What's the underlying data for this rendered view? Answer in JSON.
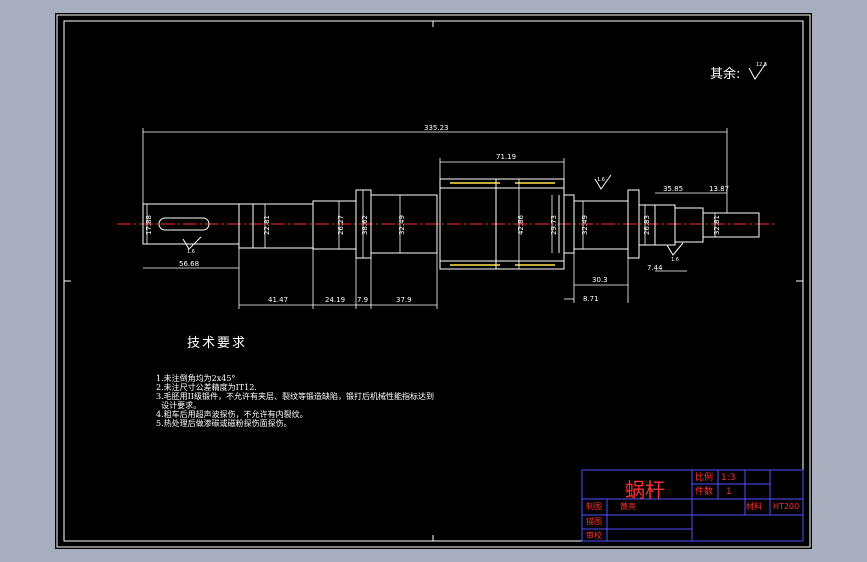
{
  "drawing": {
    "roughness_note": "其余:",
    "roughness_value": "12.5",
    "dimensions": {
      "overall_length": "335.23",
      "worm_length": "71.19",
      "keyway_width": "17.88",
      "d1": "22.81",
      "d2": "26.27",
      "d3": "38.62",
      "d4": "32.49",
      "d5": "42.86",
      "d6": "29.73",
      "d7": "32.49",
      "d8": "26.83",
      "d9": "32.81",
      "key_length": "56.68",
      "l1": "41.47",
      "l2": "24.19",
      "l3": "7.9",
      "l4": "37.9",
      "l5": "30.3",
      "l6": "8.71",
      "l7": "7.44",
      "l8": "35.85",
      "l9": "13.87"
    },
    "surface_marks": [
      "1.6",
      "1.6",
      "1.6"
    ]
  },
  "requirements": {
    "title": "技术要求",
    "items": [
      "1.未注倒角均为2x45°",
      "2.未注尺寸公差精度为IT12.",
      "3.毛胚用II级锻件，不允许有夹层、裂纹等锻造缺陷，锻打后机械性能指标达到",
      "  设计要求。",
      "4.粗车后用超声波探伤，不允许有内裂纹。",
      "5.热处理后做渗碳或磁粉探伤面探伤。"
    ]
  },
  "title_block": {
    "part_name": "蜗杆",
    "scale_label": "比例",
    "scale_value": "1:3",
    "qty_label": "件数",
    "qty_value": "1",
    "drawn_label": "制图",
    "drawn_name": "黄亮",
    "draw_check_label": "描图",
    "review_label": "审校",
    "material_label": "材料",
    "material_value": "HT200"
  }
}
